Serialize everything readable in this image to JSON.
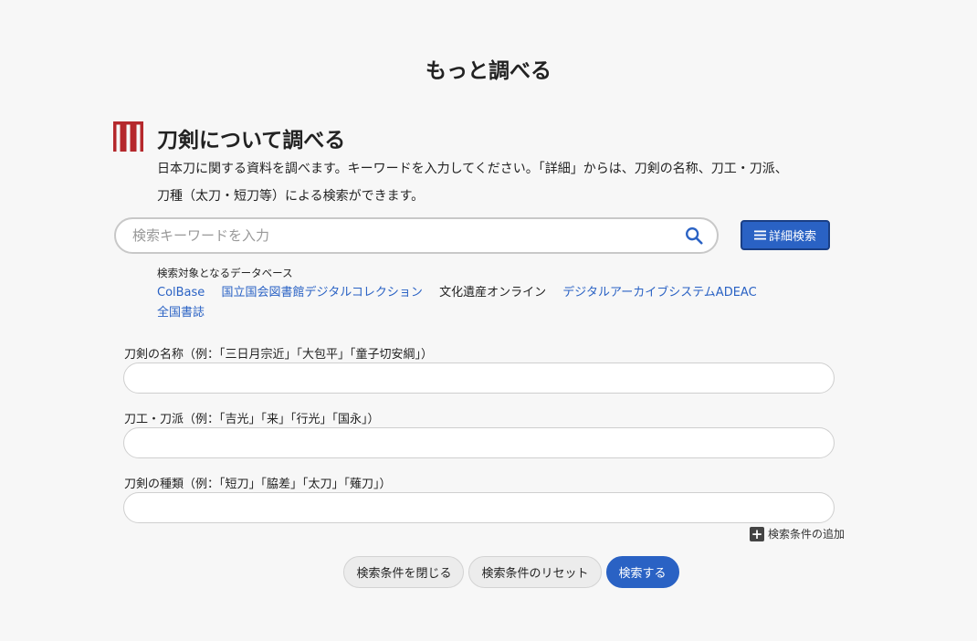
{
  "page": {
    "title": "もっと調べる"
  },
  "section": {
    "title": "刀剣について調べる",
    "description_line1": "日本刀に関する資料を調べます。キーワードを入力してください。「詳細」からは、刀剣の名称、刀工・刀派、",
    "description_line2": "刀種（太刀・短刀等）による検索ができます。",
    "icon": "sword-section-icon",
    "icon_color": "#b5282c"
  },
  "search": {
    "placeholder": "検索キーワードを入力",
    "value": "",
    "icon": "search-icon",
    "detail_button_label": "詳細検索",
    "detail_button_icon": "menu-icon"
  },
  "databases": {
    "label": "検索対象となるデータベース",
    "items": [
      {
        "label": "ColBase",
        "link": true
      },
      {
        "label": "国立国会図書館デジタルコレクション",
        "link": true
      },
      {
        "label": "文化遺産オンライン",
        "link": false
      },
      {
        "label": "デジタルアーカイブシステムADEAC",
        "link": true
      },
      {
        "label": "全国書誌",
        "link": true
      }
    ]
  },
  "fields": [
    {
      "label": "刀剣の名称（例：「三日月宗近」「大包平」「童子切安綱」）",
      "value": ""
    },
    {
      "label": "刀工・刀派（例：「吉光」「来」「行光」「国永」）",
      "value": ""
    },
    {
      "label": "刀剣の種類（例：「短刀」「脇差」「太刀」「薙刀」）",
      "value": ""
    }
  ],
  "add_condition": {
    "label": "検索条件の追加",
    "icon": "plus-icon"
  },
  "buttons": {
    "close": "検索条件を閉じる",
    "reset": "検索条件のリセット",
    "search": "検索する"
  },
  "colors": {
    "accent": "#2a62c4",
    "link": "#2a62c4",
    "background": "#f7f7f7"
  }
}
